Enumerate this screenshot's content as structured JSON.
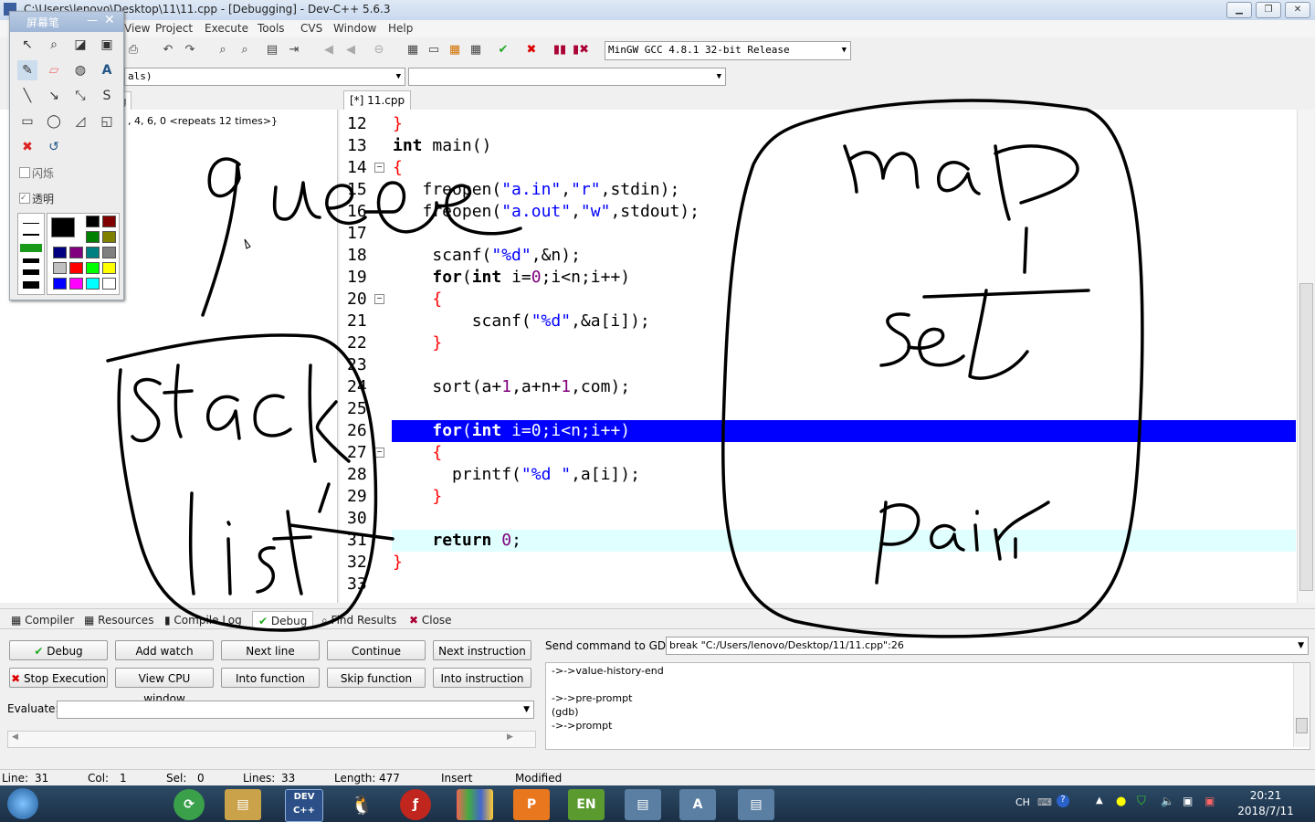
{
  "window": {
    "title": "C:\\Users\\lenovo\\Desktop\\11\\11.cpp - [Debugging] - Dev-C++ 5.6.3"
  },
  "menu": [
    "View",
    "Project",
    "Execute",
    "Tools",
    "CVS",
    "Window",
    "Help"
  ],
  "toolbar": {
    "compiler": "MinGW GCC 4.8.1 32-bit Release",
    "class_combo": "als)",
    "member_combo": ""
  },
  "left_panel": {
    "tab": "g",
    "watch_value": ", 4, 6, 0 <repeats 12 times>}"
  },
  "editor": {
    "tab": "[*] 11.cpp",
    "line_numbers": [
      "12",
      "13",
      "14",
      "15",
      "16",
      "17",
      "18",
      "19",
      "20",
      "21",
      "22",
      "23",
      "24",
      "25",
      "26",
      "27",
      "28",
      "29",
      "30",
      "31",
      "32",
      "33"
    ],
    "highlight_line": "26",
    "current_line": "31"
  },
  "bottom_tabs": [
    "Compiler",
    "Resources",
    "Compile Log",
    "Debug",
    "Find Results",
    "Close"
  ],
  "debug": {
    "buttons_row1": [
      "Debug",
      "Add watch",
      "Next line",
      "Continue",
      "Next instruction"
    ],
    "buttons_row2": [
      "Stop Execution",
      "View CPU window",
      "Into function",
      "Skip function",
      "Into instruction"
    ],
    "evaluate_label": "Evaluate:",
    "evaluate_value": "",
    "gdb_label": "Send command to GDB:",
    "gdb_command": "break \"C:/Users/lenovo/Desktop/11/11.cpp\":26",
    "output": [
      "->->value-history-end",
      "",
      "->->pre-prompt",
      "(gdb)",
      "->->prompt"
    ]
  },
  "status": {
    "line_label": "Line:",
    "line": "31",
    "col_label": "Col:",
    "col": "1",
    "sel_label": "Sel:",
    "sel": "0",
    "lines_label": "Lines:",
    "lines": "33",
    "length_label": "Length:",
    "length": "477",
    "mode": "Insert",
    "state": "Modified"
  },
  "taskbar": {
    "time": "20:21",
    "date": "2018/7/11",
    "lang": "CH",
    "apps": [
      "DEV C++",
      "EN"
    ]
  },
  "pen_panel": {
    "title": "屏幕笔",
    "blink_label": "闪烁",
    "transparent_label": "透明"
  },
  "handwriting": [
    "queue",
    "map",
    "set",
    "stack",
    "list",
    "pair"
  ],
  "colors": {
    "highlight": "#0000ff",
    "current_line": "#e0ffff",
    "keyword": "#000000",
    "string": "#0000ff",
    "number": "#800080"
  }
}
